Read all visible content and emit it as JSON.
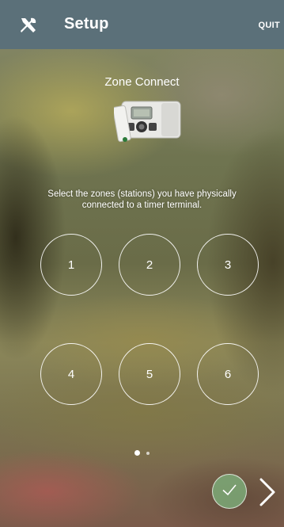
{
  "header": {
    "title": "Setup",
    "quit_label": "QUIT",
    "left_icon": "tools-icon"
  },
  "main": {
    "heading": "Zone Connect",
    "device_image": "sprinkler-timer-device",
    "instruction": "Select the zones (stations) you have physically connected to a timer terminal.",
    "zones": [
      "1",
      "2",
      "3",
      "4",
      "5",
      "6"
    ]
  },
  "pager": {
    "total": 2,
    "active_index": 0
  },
  "footer": {
    "confirm_icon": "check-icon",
    "next_icon": "chevron-right-icon"
  },
  "colors": {
    "header_bg": "#5b7079",
    "confirm_bg": "#7caa78",
    "text": "#ffffff"
  }
}
